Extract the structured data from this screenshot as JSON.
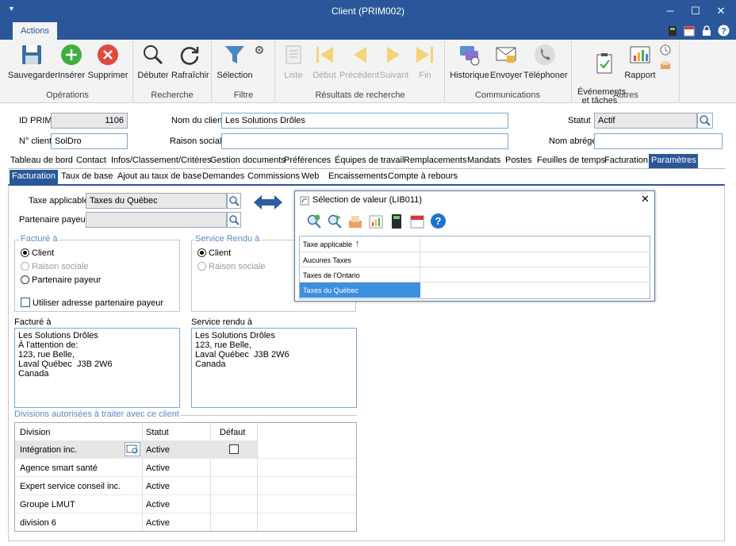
{
  "window": {
    "title": "Client (PRIM002)",
    "minimize": "─",
    "maximize": "☐",
    "close": "✕"
  },
  "ribbon": {
    "tab": "Actions",
    "buttons": {
      "save": "Sauvegarder",
      "insert": "Insérer",
      "delete": "Supprimer",
      "start": "Débuter",
      "refresh": "Rafraîchir",
      "selection": "Sélection",
      "list": "Liste",
      "first": "Début",
      "previous": "Précédent",
      "next": "Suivant",
      "last": "Fin",
      "history": "Historique",
      "send": "Envoyer",
      "phone": "Téléphoner",
      "events": "Événements\net tâches",
      "report": "Rapport"
    },
    "groups": {
      "operations": "Opérations",
      "search": "Recherche",
      "filter": "Filtre",
      "results": "Résultats de recherche",
      "communications": "Communications",
      "others": "Autres"
    }
  },
  "header": {
    "id_label": "ID PRIM",
    "id_value": "1106",
    "client_name_label": "Nom du client",
    "client_name_value": "Les Solutions Drôles",
    "status_label": "Statut",
    "status_value": "Actif",
    "client_no_label": "N° client",
    "client_no_value": "SolDro",
    "company_label": "Raison sociale",
    "company_value": "",
    "short_name_label": "Nom abrégé",
    "short_name_value": ""
  },
  "main_tabs": [
    "Tableau de bord",
    "Contact",
    "Infos/Classement/Critères",
    "Gestion documents",
    "Préférences",
    "Équipes de travail",
    "Remplacements",
    "Mandats",
    "Postes",
    "Feuilles de temps",
    "Facturation",
    "Paramètres"
  ],
  "sub_tabs": [
    "Facturation",
    "Taux de base",
    "Ajout au taux de base",
    "Demandes",
    "Commissions",
    "Web",
    "Encaissements",
    "Compte à rebours"
  ],
  "billing": {
    "tax_label": "Taxe applicable",
    "tax_value": "Taxes du Québec",
    "payer_label": "Partenaire payeur",
    "payer_value": "",
    "billed_to_legend": "Facturé à",
    "billed_options": [
      "Client",
      "Raison sociale",
      "Partenaire payeur"
    ],
    "use_payer_address": "Utiliser adresse partenaire payeur",
    "service_legend": "Service Rendu à",
    "service_options": [
      "Client",
      "Raison sociale"
    ],
    "billed_addr_label": "Facturé à",
    "billed_addr": "Les Solutions Drôles\nÀ l'attention de:\n123, rue Belle,\nLaval Québec  J3B 2W6\nCanada",
    "service_addr_label": "Service rendu à",
    "service_addr": "Les Solutions Drôles\n123, rue Belle,\nLaval Québec  J3B 2W6\nCanada"
  },
  "divisions": {
    "legend": "Divisions autorisées à traiter avec ce client",
    "headers": [
      "Division",
      "Statut",
      "Défaut"
    ],
    "rows": [
      {
        "division": "Intégration inc.",
        "status": "Active"
      },
      {
        "division": "Agence smart santé",
        "status": "Active"
      },
      {
        "division": "Expert service conseil inc.",
        "status": "Active"
      },
      {
        "division": "Groupe LMUT",
        "status": "Active"
      },
      {
        "division": "division 6",
        "status": "Active"
      }
    ]
  },
  "dialog": {
    "title": "Sélection de valeur (LIB011)",
    "column": "Taxe applicable",
    "sort_icon": "↑",
    "items": [
      "Aucunes Taxes",
      "Taxes de l'Ontario",
      "Taxes du Québec"
    ],
    "selected": "Taxes du Québec"
  },
  "colors": {
    "accent": "#2b579a",
    "selection": "#3d8fe0",
    "ribbon_bg": "#f3f3f3"
  }
}
